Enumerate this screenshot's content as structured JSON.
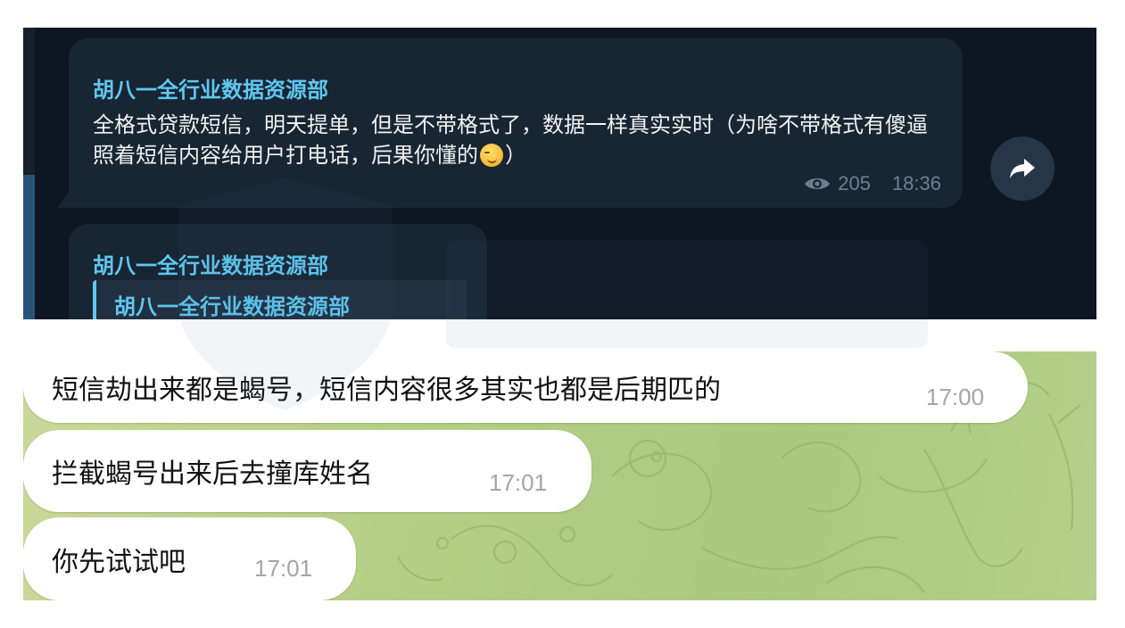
{
  "dark_chat": {
    "message_1": {
      "sender": "胡八一全行业数据资源部",
      "text_before_emoji": "全格式贷款短信，明天提单，但是不带格式了，数据一样真实实时（为啥不带格式有傻逼照着短信内容给用户打电话，后果你懂的",
      "emoji_icon": "smirking-face-icon",
      "text_after_emoji": "）",
      "views": "205",
      "time": "18:36"
    },
    "message_2": {
      "sender": "胡八一全行业数据资源部",
      "forwarded_from": "胡八一全行业数据资源部"
    },
    "forward_icon": "share-arrow-icon",
    "colors": {
      "background": "#0e1621",
      "bubble": "#182533",
      "accent": "#5fc7f0"
    }
  },
  "light_chat": {
    "messages": [
      {
        "text": "短信劫出来都是蝎号，短信内容很多其实也都是后期匹的",
        "time": "17:00"
      },
      {
        "text": "拦截蝎号出来后去撞库姓名",
        "time": "17:01"
      },
      {
        "text": "你先试试吧",
        "time": "17:01"
      }
    ],
    "colors": {
      "bubble": "#ffffff",
      "time": "#a5a5a5"
    }
  }
}
